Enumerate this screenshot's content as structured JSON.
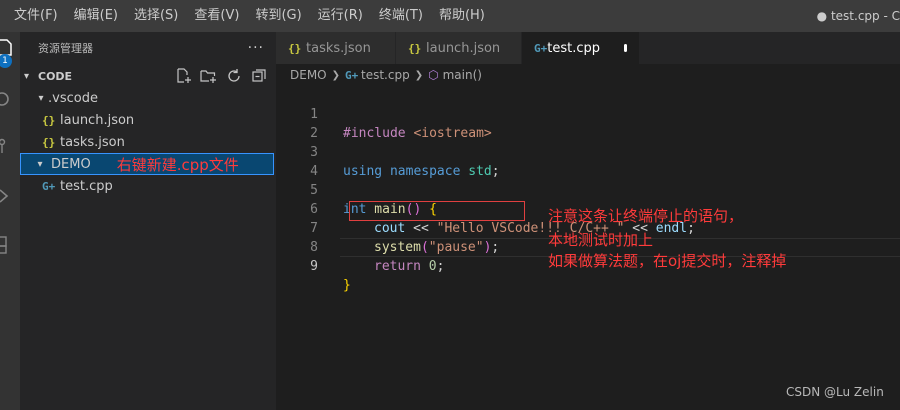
{
  "menu": [
    "文件(F)",
    "编辑(E)",
    "选择(S)",
    "查看(V)",
    "转到(G)",
    "运行(R)",
    "终端(T)",
    "帮助(H)"
  ],
  "window_title": "● test.cpp - C",
  "activity": {
    "badge": "1"
  },
  "explorer": {
    "title": "资源管理器",
    "more": "···",
    "section": "CODE",
    "vscode_folder": ".vscode",
    "files_vscode": [
      "launch.json",
      "tasks.json"
    ],
    "demo_folder": "DEMO",
    "demo_note": "右键新建.cpp文件",
    "demo_files": [
      "test.cpp"
    ]
  },
  "tabs": [
    {
      "label": "tasks.json",
      "icon": "{}"
    },
    {
      "label": "launch.json",
      "icon": "{}"
    },
    {
      "label": "test.cpp",
      "icon": "G+"
    }
  ],
  "breadcrumb": {
    "folder": "DEMO",
    "file": "test.cpp",
    "symbol": "main()"
  },
  "code": {
    "line_numbers": [
      "1",
      "2",
      "3",
      "4",
      "5",
      "6",
      "7",
      "8",
      "9"
    ],
    "l1_directive": "#include",
    "l1_header": " <iostream>",
    "l3_using": "using",
    "l3_namespace": " namespace",
    "l3_std": " std",
    "l3_semi": ";",
    "l5_int": "int",
    "l5_main": " main",
    "l5_parens": "()",
    "l5_brace": " {",
    "l6_cout": "cout",
    "l6_op1": " << ",
    "l6_str": "\"Hello VSCode!!! C/C++ \"",
    "l6_op2": " << ",
    "l6_endl": "endl",
    "l6_semi": ";",
    "l7_system": "system",
    "l7_open": "(",
    "l7_str": "\"pause\"",
    "l7_close": ")",
    "l7_semi": ";",
    "l8_return": "return",
    "l8_zero": " 0",
    "l8_semi": ";",
    "l9_brace": "}"
  },
  "notes": [
    "注意这条让终端停止的语句，",
    "本地测试时加上",
    "如果做算法题，在oj提交时，注释掉"
  ],
  "watermark": "CSDN @Lu Zelin"
}
